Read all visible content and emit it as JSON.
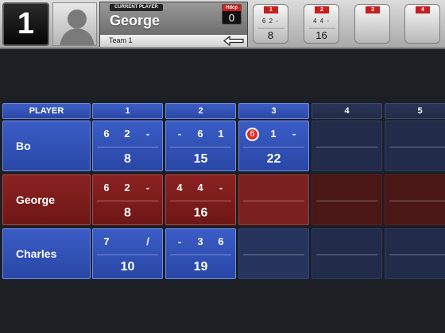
{
  "header": {
    "lane_number": "1",
    "current_player_label": "CURRENT PLAYER",
    "current_player_name": "George",
    "team_name": "Team 1",
    "hdcp_label": "Hdcp",
    "hdcp_value": "0"
  },
  "frame_buttons": [
    {
      "number": "1",
      "throws": "6 2 -",
      "total": "8"
    },
    {
      "number": "2",
      "throws": "4 4 -",
      "total": "16"
    },
    {
      "number": "3",
      "throws": "",
      "total": ""
    },
    {
      "number": "4",
      "throws": "",
      "total": ""
    }
  ],
  "scoreboard": {
    "player_header": "PLAYER",
    "frame_headers": [
      "1",
      "2",
      "3",
      "4",
      "5"
    ],
    "players": [
      {
        "name": "Bo",
        "frames": [
          {
            "throws": [
              "6",
              "2",
              "-"
            ],
            "total": "8"
          },
          {
            "throws": [
              "-",
              "6",
              "1"
            ],
            "total": "15"
          },
          {
            "throws": [
              "6",
              "1",
              "-"
            ],
            "split_first": true,
            "total": "22"
          }
        ]
      },
      {
        "name": "George",
        "frames": [
          {
            "throws": [
              "6",
              "2",
              "-"
            ],
            "total": "8"
          },
          {
            "throws": [
              "4",
              "4",
              "-"
            ],
            "total": "16"
          }
        ]
      },
      {
        "name": "Charles",
        "frames": [
          {
            "throws": [
              "7",
              "",
              "/"
            ],
            "total": "10"
          },
          {
            "throws": [
              "-",
              "3",
              "6"
            ],
            "total": "19"
          }
        ]
      }
    ]
  },
  "colors": {
    "accent_blue": "#2f4fb5",
    "active_red": "#7a1c1c",
    "background": "#1c1f24",
    "badge_red": "#c61f1f"
  }
}
